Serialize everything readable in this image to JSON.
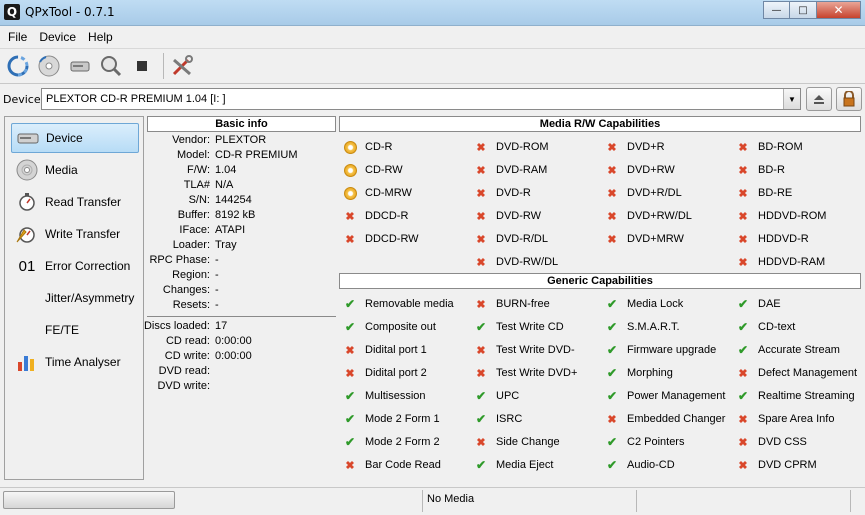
{
  "window": {
    "title": "QPxTool - 0.7.1",
    "app_icon": "Q"
  },
  "menu": [
    "File",
    "Device",
    "Help"
  ],
  "toolbar": {
    "icons": [
      "refresh-icon",
      "disc-scan-icon",
      "drive-icon",
      "magnify-icon",
      "stop-icon",
      "tools-icon"
    ]
  },
  "device": {
    "label": "Device:",
    "value": "PLEXTOR  CD-R   PREMIUM   1.04 [I: ]"
  },
  "nav": [
    {
      "label": "Device",
      "icon": "drive-icon",
      "active": true
    },
    {
      "label": "Media",
      "icon": "disc-icon"
    },
    {
      "label": "Read Transfer",
      "icon": "stopwatch-icon"
    },
    {
      "label": "Write Transfer",
      "icon": "write-stopwatch-icon"
    },
    {
      "label": "Error Correction",
      "icon": "binary-icon",
      "prefix": "01"
    },
    {
      "label": "Jitter/Asymmetry"
    },
    {
      "label": "FE/TE"
    },
    {
      "label": "Time Analyser",
      "icon": "chart-icon"
    }
  ],
  "basic_info": {
    "title": "Basic info",
    "rows": [
      {
        "k": "Vendor:",
        "v": "PLEXTOR"
      },
      {
        "k": "Model:",
        "v": "CD-R   PREMIUM"
      },
      {
        "k": "F/W:",
        "v": "1.04"
      },
      {
        "k": "TLA#",
        "v": "N/A"
      },
      {
        "k": "S/N:",
        "v": "144254"
      },
      {
        "k": "Buffer:",
        "v": "8192 kB"
      },
      {
        "k": "IFace:",
        "v": "ATAPI"
      },
      {
        "k": "Loader:",
        "v": "Tray"
      },
      {
        "k": "RPC Phase:",
        "v": "-"
      },
      {
        "k": "Region:",
        "v": "-"
      },
      {
        "k": "Changes:",
        "v": "-"
      },
      {
        "k": "Resets:",
        "v": "-"
      }
    ],
    "rows2": [
      {
        "k": "Discs loaded:",
        "v": "17"
      },
      {
        "k": "CD read:",
        "v": "0:00:00"
      },
      {
        "k": "CD write:",
        "v": "0:00:00"
      },
      {
        "k": "DVD read:",
        "v": ""
      },
      {
        "k": "DVD write:",
        "v": ""
      }
    ]
  },
  "media_rw": {
    "title": "Media R/W Capabilities",
    "cols": [
      [
        {
          "t": "CD-R",
          "s": "disc"
        },
        {
          "t": "CD-RW",
          "s": "disc"
        },
        {
          "t": "CD-MRW",
          "s": "disc"
        },
        {
          "t": "DDCD-R",
          "s": "x"
        },
        {
          "t": "DDCD-RW",
          "s": "x"
        }
      ],
      [
        {
          "t": "DVD-ROM",
          "s": "x"
        },
        {
          "t": "DVD-RAM",
          "s": "x"
        },
        {
          "t": "DVD-R",
          "s": "x"
        },
        {
          "t": "DVD-RW",
          "s": "x"
        },
        {
          "t": "DVD-R/DL",
          "s": "x"
        },
        {
          "t": "DVD-RW/DL",
          "s": "x"
        }
      ],
      [
        {
          "t": "DVD+R",
          "s": "x"
        },
        {
          "t": "DVD+RW",
          "s": "x"
        },
        {
          "t": "DVD+R/DL",
          "s": "x"
        },
        {
          "t": "DVD+RW/DL",
          "s": "x"
        },
        {
          "t": "DVD+MRW",
          "s": "x"
        }
      ],
      [
        {
          "t": "BD-ROM",
          "s": "x"
        },
        {
          "t": "BD-R",
          "s": "x"
        },
        {
          "t": "BD-RE",
          "s": "x"
        },
        {
          "t": "HDDVD-ROM",
          "s": "x"
        },
        {
          "t": "HDDVD-R",
          "s": "x"
        },
        {
          "t": "HDDVD-RAM",
          "s": "x"
        }
      ]
    ]
  },
  "generic": {
    "title": "Generic Capabilities",
    "cols": [
      [
        {
          "t": "Removable media",
          "s": "ok"
        },
        {
          "t": "Composite out",
          "s": "ok"
        },
        {
          "t": "Didital port 1",
          "s": "x"
        },
        {
          "t": "Didital port 2",
          "s": "x"
        },
        {
          "t": "Multisession",
          "s": "ok"
        },
        {
          "t": "Mode 2 Form 1",
          "s": "ok"
        },
        {
          "t": "Mode 2 Form 2",
          "s": "ok"
        },
        {
          "t": "Bar Code Read",
          "s": "x"
        }
      ],
      [
        {
          "t": "BURN-free",
          "s": "x"
        },
        {
          "t": "Test Write CD",
          "s": "ok"
        },
        {
          "t": "Test Write DVD-",
          "s": "x"
        },
        {
          "t": "Test Write DVD+",
          "s": "x"
        },
        {
          "t": "UPC",
          "s": "ok"
        },
        {
          "t": "ISRC",
          "s": "ok"
        },
        {
          "t": "Side Change",
          "s": "x"
        },
        {
          "t": "Media Eject",
          "s": "ok"
        }
      ],
      [
        {
          "t": "Media Lock",
          "s": "ok"
        },
        {
          "t": "S.M.A.R.T.",
          "s": "ok"
        },
        {
          "t": "Firmware upgrade",
          "s": "ok"
        },
        {
          "t": "Morphing",
          "s": "ok"
        },
        {
          "t": "Power Management",
          "s": "ok"
        },
        {
          "t": "Embedded Changer",
          "s": "x"
        },
        {
          "t": "C2 Pointers",
          "s": "ok"
        },
        {
          "t": "Audio-CD",
          "s": "ok"
        }
      ],
      [
        {
          "t": "DAE",
          "s": "ok"
        },
        {
          "t": "CD-text",
          "s": "ok"
        },
        {
          "t": "Accurate Stream",
          "s": "ok"
        },
        {
          "t": "Defect Management",
          "s": "x"
        },
        {
          "t": "Realtime Streaming",
          "s": "ok"
        },
        {
          "t": "Spare Area Info",
          "s": "x"
        },
        {
          "t": "DVD CSS",
          "s": "x"
        },
        {
          "t": "DVD CPRM",
          "s": "x"
        }
      ]
    ]
  },
  "status": {
    "text": "No Media"
  }
}
